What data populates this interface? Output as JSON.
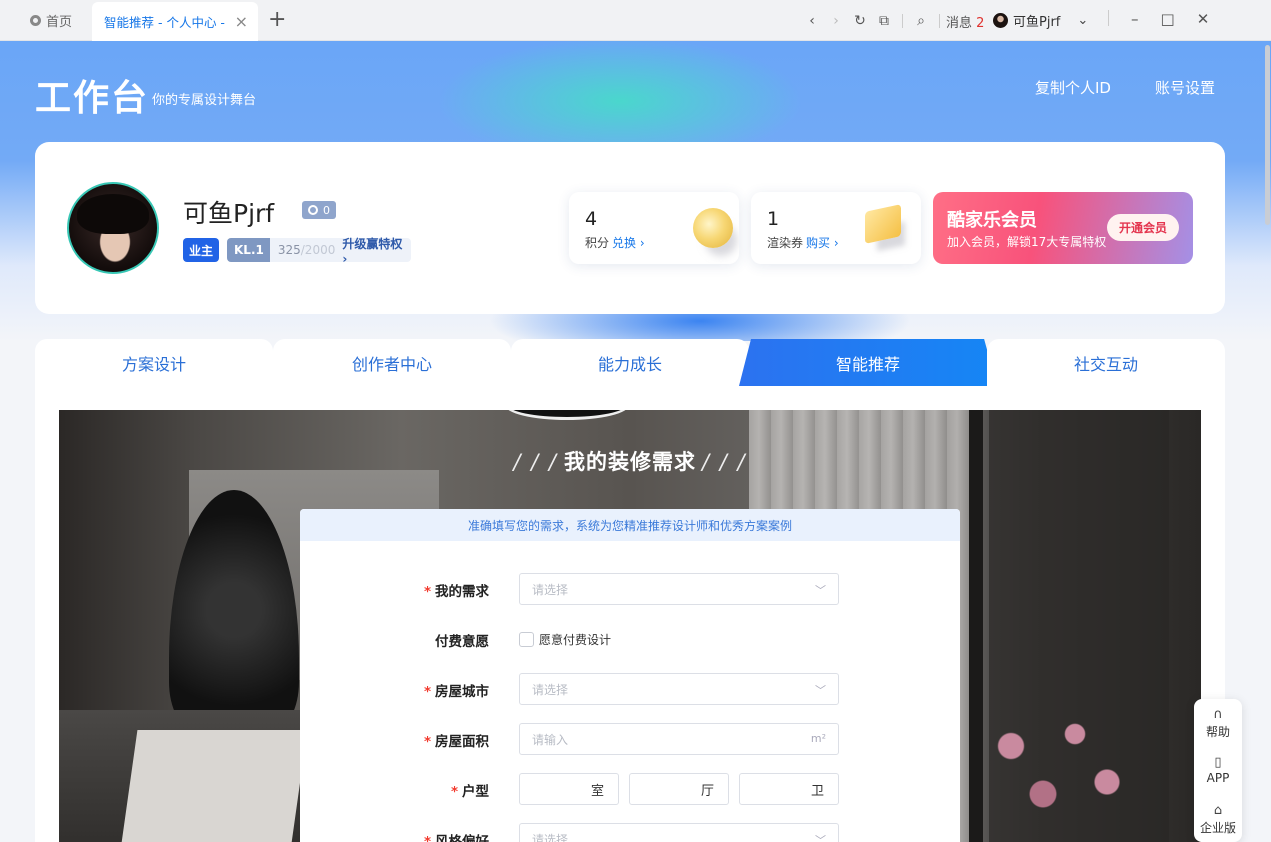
{
  "browser": {
    "home_tab": "首页",
    "active_tab": "智能推荐 - 个人中心 -",
    "messages_label": "消息",
    "messages_count": "2",
    "user_name": "可鱼Pjrf"
  },
  "header": {
    "logo": "工作台",
    "slogan": "你的专属设计舞台",
    "copy_id": "复制个人ID",
    "account_settings": "账号设置"
  },
  "profile": {
    "name": "可鱼Pjrf",
    "vip_count": "0",
    "role_tag": "业主",
    "level": "KL.1",
    "level_points": "325",
    "level_total": "/2000",
    "upgrade_link": "升级赢特权 ›"
  },
  "stats": [
    {
      "value": "4",
      "label": "积分",
      "action": "兑换 ›"
    },
    {
      "value": "1",
      "label": "渲染券",
      "action": "购买 ›"
    }
  ],
  "vip_card": {
    "title": "酷家乐会员",
    "subtitle": "加入会员，解锁17大专属特权",
    "button": "开通会员"
  },
  "tabs": [
    {
      "label": "方案设计",
      "active": false
    },
    {
      "label": "创作者中心",
      "active": false
    },
    {
      "label": "能力成长",
      "active": false
    },
    {
      "label": "智能推荐",
      "active": true
    },
    {
      "label": "社交互动",
      "active": false
    }
  ],
  "form": {
    "title": "我的装修需求",
    "tip": "准确填写您的需求，系统为您精准推荐设计师和优秀方案案例",
    "fields": {
      "demand": {
        "label": "我的需求",
        "required": true,
        "placeholder": "请选择"
      },
      "pay": {
        "label": "付费意愿",
        "required": false,
        "option": "愿意付费设计"
      },
      "city": {
        "label": "房屋城市",
        "required": true,
        "placeholder": "请选择"
      },
      "area": {
        "label": "房屋面积",
        "required": true,
        "placeholder": "请输入",
        "unit": "m²"
      },
      "layout": {
        "label": "户型",
        "required": true,
        "room": "室",
        "hall": "厅",
        "bath": "卫"
      },
      "style": {
        "label": "风格偏好",
        "required": true,
        "placeholder": "请选择"
      }
    }
  },
  "helper": {
    "help": "帮助",
    "app": "APP",
    "enterprise": "企业版"
  }
}
